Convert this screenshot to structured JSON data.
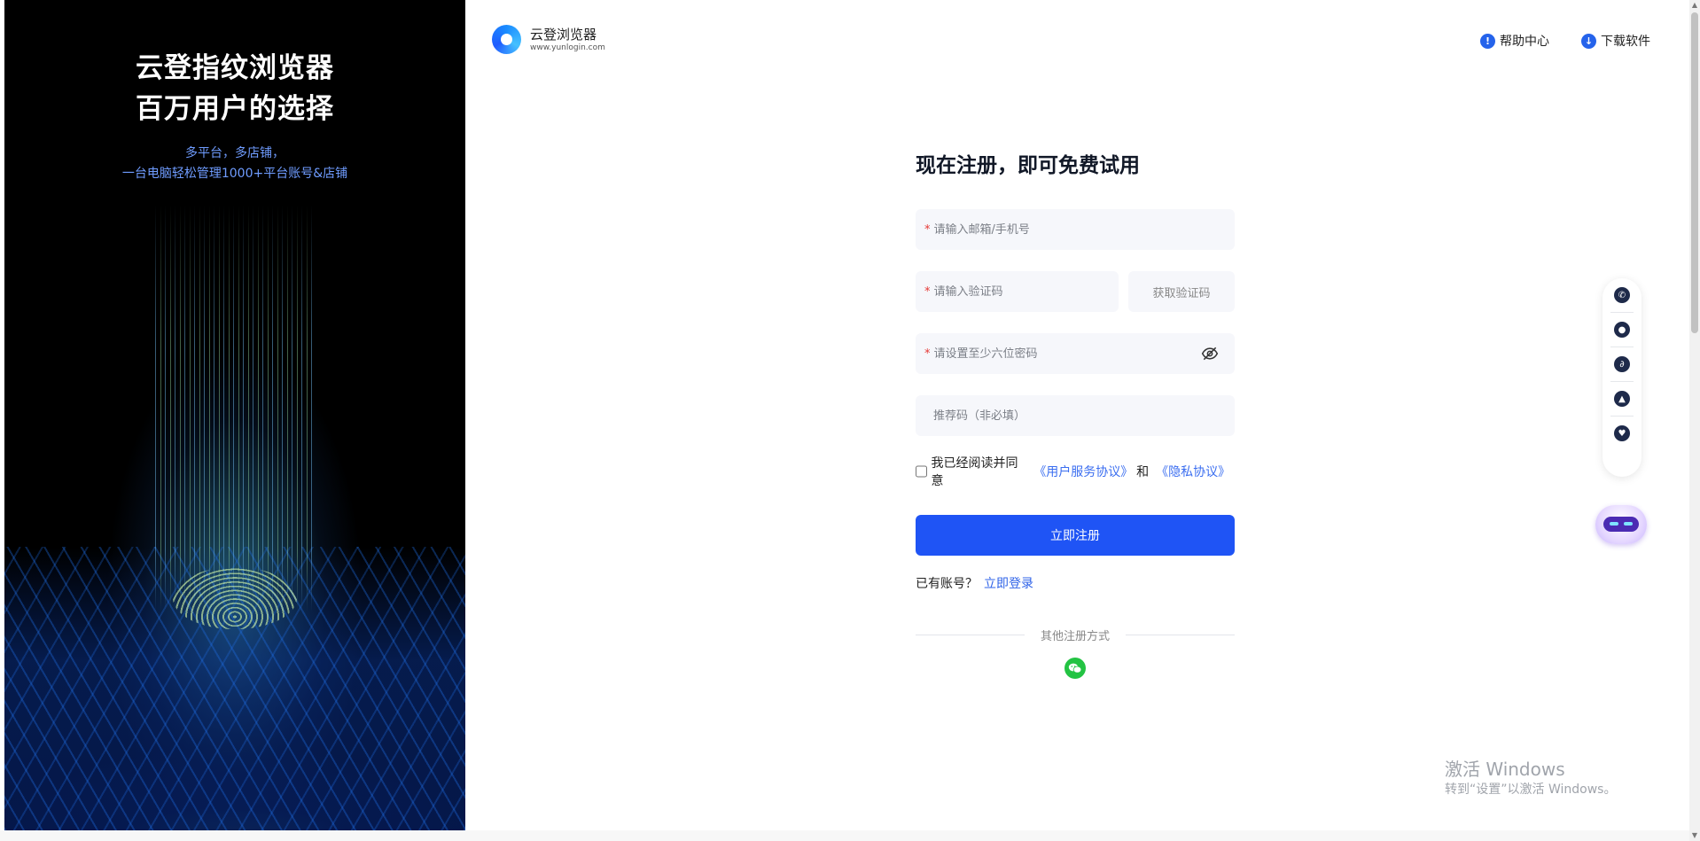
{
  "promo": {
    "title_line1": "云登指纹浏览器",
    "title_line2": "百万用户的选择",
    "sub_line1": "多平台，多店铺，",
    "sub_line2": "一台电脑轻松管理1000+平台账号&店铺"
  },
  "header": {
    "brand_name": "云登浏览器",
    "brand_url": "www.yunlogin.com",
    "help_label": "帮助中心",
    "help_icon": "!",
    "download_label": "下载软件",
    "download_icon": "↓"
  },
  "form": {
    "title": "现在注册，即可免费试用",
    "required_mark": "*",
    "account_placeholder": "请输入邮箱/手机号",
    "code_placeholder": "请输入验证码",
    "get_code_label": "获取验证码",
    "password_placeholder": "请设置至少六位密码",
    "referral_placeholder": "推荐码（非必填）",
    "agree_prefix": "我已经阅读并同意",
    "terms_link": "《用户服务协议》",
    "and": "和",
    "privacy_link": "《隐私协议》",
    "submit_label": "立即注册",
    "have_account": "已有账号？",
    "login_link": "立即登录",
    "other_methods": "其他注册方式"
  },
  "side_tools": [
    "phone-icon",
    "wechat-icon",
    "link-icon",
    "qq-icon",
    "heart-icon"
  ],
  "watermark": {
    "line1": "激活 Windows",
    "line2": "转到“设置”以激活 Windows。"
  },
  "colors": {
    "primary": "#1f54f5",
    "link": "#3b6ef0",
    "required": "#e53935",
    "wechat": "#23c343"
  }
}
